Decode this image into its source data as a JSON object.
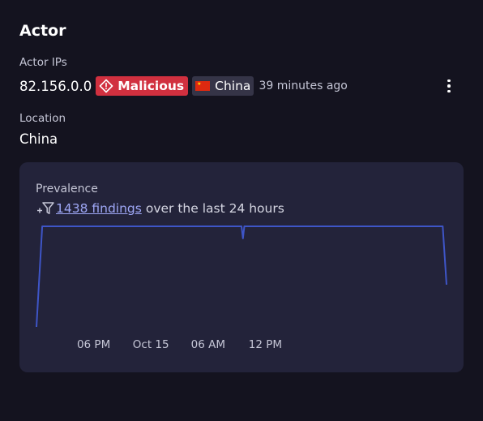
{
  "actor": {
    "title": "Actor",
    "ips_label": "Actor IPs",
    "ip": "82.156.0.0",
    "verdict": "Malicious",
    "country": "China",
    "seen": "39 minutes ago",
    "location_label": "Location",
    "location": "China"
  },
  "prevalence": {
    "title": "Prevalence",
    "findings_link": "1438 findings",
    "findings_suffix": "over the last 24 hours"
  },
  "colors": {
    "background": "#14131f",
    "card": "#23233a",
    "malicious": "#d1303f",
    "country_badge": "#353447",
    "link": "#9ea7f5",
    "line": "#3e55c7"
  },
  "icons": {
    "verdict": "warning-diamond-icon",
    "country": "china-flag-icon",
    "menu": "kebab-menu-icon",
    "findings": "add-filter-icon"
  },
  "chart_data": {
    "type": "line",
    "title": "",
    "xlabel": "",
    "ylabel": "",
    "x_ticks": [
      "06 PM",
      "Oct 15",
      "06 AM",
      "12 PM"
    ],
    "x": [
      0,
      0.6,
      1,
      21.5,
      21.65,
      21.8,
      42.5,
      42.6,
      43
    ],
    "y": [
      0,
      1,
      1,
      1,
      0.88,
      1,
      1,
      1,
      0.42
    ],
    "ylim": [
      0,
      1
    ],
    "grid": false
  }
}
